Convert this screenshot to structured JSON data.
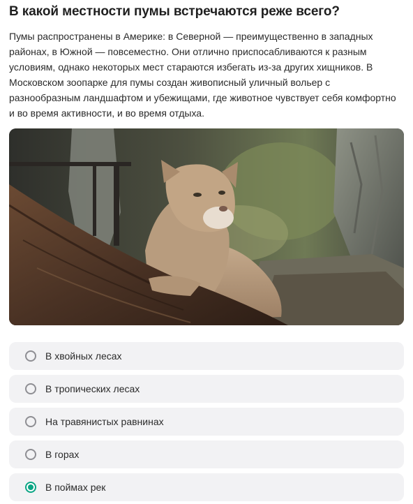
{
  "question": {
    "title": "В какой местности пумы встречаются реже всего?",
    "text": "Пумы распространены в Америке: в Северной — преимущественно в западных районах, в Южной — повсеместно. Они отлично приспосабливаются к разным условиям, однако некоторых мест стараются избегать из-за других хищников. В Московском зоопарке для пумы создан живописный уличный вольер с разнообразным ландшафтом и убежищами, где животное чувствует себя комфортно и во время активности, и во время отдыха."
  },
  "options": [
    {
      "label": "В хвойных лесах",
      "selected": false
    },
    {
      "label": "В тропических лесах",
      "selected": false
    },
    {
      "label": "На травянистых равнинах",
      "selected": false
    },
    {
      "label": "В горах",
      "selected": false
    },
    {
      "label": "В поймах рек",
      "selected": true
    }
  ],
  "colors": {
    "accent": "#0aa584",
    "option_bg": "#f2f2f4",
    "radio_border": "#8e8e93"
  }
}
